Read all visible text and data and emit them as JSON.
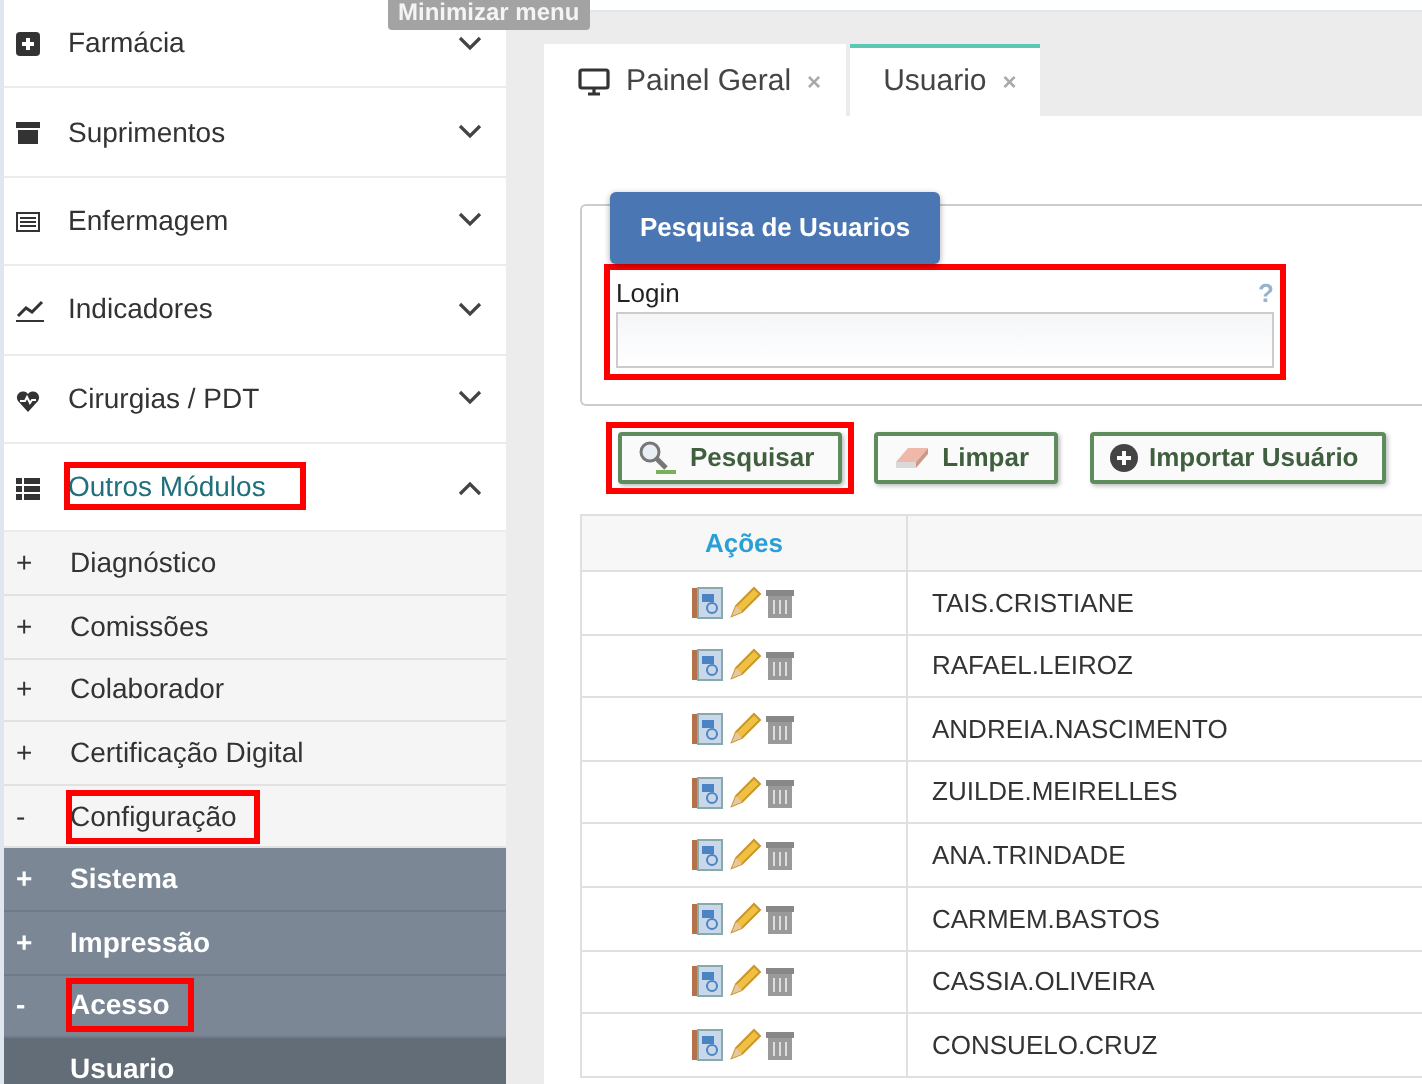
{
  "tooltip": {
    "text": "Minimizar menu"
  },
  "sidebar": {
    "items": [
      {
        "label": "Farmácia",
        "expanded": false,
        "highlighted": false
      },
      {
        "label": "Suprimentos",
        "expanded": false,
        "highlighted": false
      },
      {
        "label": "Enfermagem",
        "expanded": false,
        "highlighted": false
      },
      {
        "label": "Indicadores",
        "expanded": false,
        "highlighted": false
      },
      {
        "label": "Cirurgias / PDT",
        "expanded": false,
        "highlighted": false
      },
      {
        "label": "Outros Módulos",
        "expanded": true,
        "highlighted": true,
        "children": [
          {
            "sign": "+",
            "label": "Diagnóstico",
            "expanded": false,
            "highlighted": false
          },
          {
            "sign": "+",
            "label": "Comissões",
            "expanded": false,
            "highlighted": false
          },
          {
            "sign": "+",
            "label": "Colaborador",
            "expanded": false,
            "highlighted": false
          },
          {
            "sign": "+",
            "label": "Certificação Digital",
            "expanded": false,
            "highlighted": false
          },
          {
            "sign": "-",
            "label": "Configuração",
            "expanded": true,
            "highlighted": true,
            "children": [
              {
                "sign": "+",
                "label": "Sistema",
                "expanded": false,
                "highlighted": false
              },
              {
                "sign": "+",
                "label": "Impressão",
                "expanded": false,
                "highlighted": false
              },
              {
                "sign": "-",
                "label": "Acesso",
                "expanded": true,
                "highlighted": true,
                "children": [
                  {
                    "label": "Usuario",
                    "selected": true
                  }
                ]
              }
            ]
          }
        ]
      }
    ]
  },
  "tabs": [
    {
      "label": "Painel Geral",
      "close": "×",
      "selected": false
    },
    {
      "label": "Usuario",
      "close": "×",
      "selected": true
    }
  ],
  "search_panel": {
    "title": "Pesquisa de Usuarios",
    "field": {
      "label": "Login",
      "help": "?",
      "highlighted": true
    },
    "buttons": [
      {
        "label": "Pesquisar",
        "highlighted": true
      },
      {
        "label": "Limpar",
        "highlighted": false
      },
      {
        "label": "Importar Usuário",
        "highlighted": false
      }
    ]
  },
  "table": {
    "columns": [
      "Ações"
    ],
    "rows": [
      "TAIS.CRISTIANE",
      "RAFAEL.LEIROZ",
      "ANDREIA.NASCIMENTO",
      "ZUILDE.MEIRELLES",
      "ANA.TRINDADE",
      "CARMEM.BASTOS",
      "CASSIA.OLIVEIRA",
      "CONSUELO.CRUZ"
    ]
  }
}
